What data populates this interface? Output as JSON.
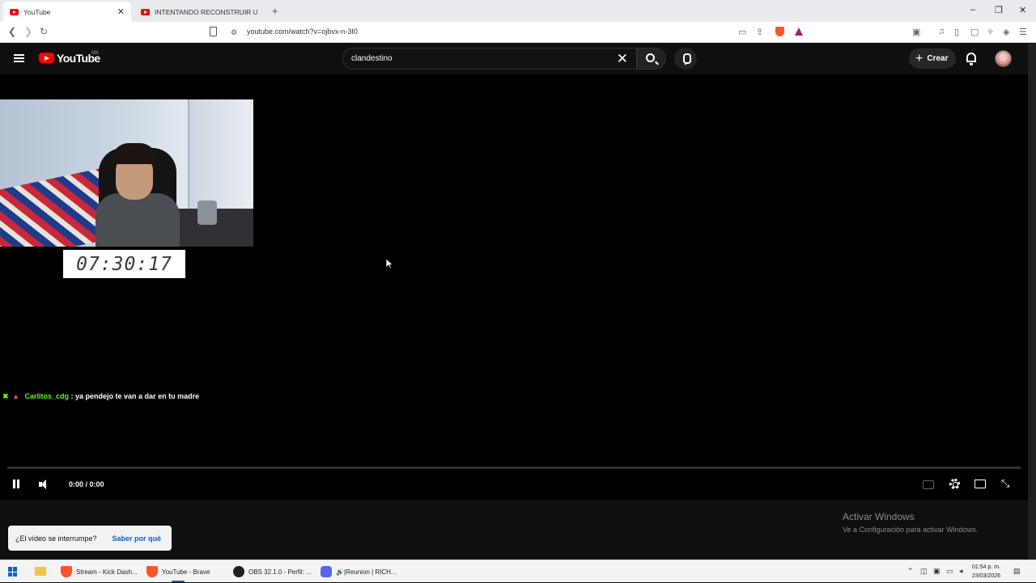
{
  "browser": {
    "tabs": [
      {
        "title": "YouTube",
        "active": true
      },
      {
        "title": "INTENTANDO RECONSTRUIR UN BU",
        "active": false
      }
    ],
    "new_tab": "+",
    "window_controls": {
      "minimize": "–",
      "restore": "❐",
      "close": "✕"
    },
    "url": "youtube.com/watch?v=ojbvx-n-3I0"
  },
  "youtube": {
    "logo_text": "YouTube",
    "country_code": "MX",
    "search": {
      "value": "clandestino",
      "clear": "✕"
    },
    "create_label": "Crear",
    "create_plus": "+"
  },
  "player": {
    "clock": "07:30:17",
    "chat": {
      "badge1": "✖",
      "badge2": "▲",
      "user": "Carlitos_cdg",
      "message": ": ya pendejo te van a dar en tu madre"
    },
    "time": "0:00 / 0:00",
    "progress": 0
  },
  "toast": {
    "question": "¿El vídeo se interrumpe?",
    "link": "Saber por qué"
  },
  "watermark": {
    "line1": "Activar Windows",
    "line2": "Ve a Configuración para activar Windows."
  },
  "taskbar": {
    "apps": [
      {
        "label": "Stream - Kick Dash...",
        "icon": "brave-icon"
      },
      {
        "label": "YouTube - Brave",
        "icon": "brave-icon"
      },
      {
        "label": "OBS 32.1.0 - Perfil: ...",
        "icon": "obs-icon"
      },
      {
        "label": "🔊|Reunion | RICH...",
        "icon": "discord-icon"
      }
    ],
    "time": "01:54 p. m.",
    "date": "23/03/2026"
  },
  "colors": {
    "accent": "#ff0000",
    "chat_user": "#53fc18",
    "link": "#065fd4"
  }
}
